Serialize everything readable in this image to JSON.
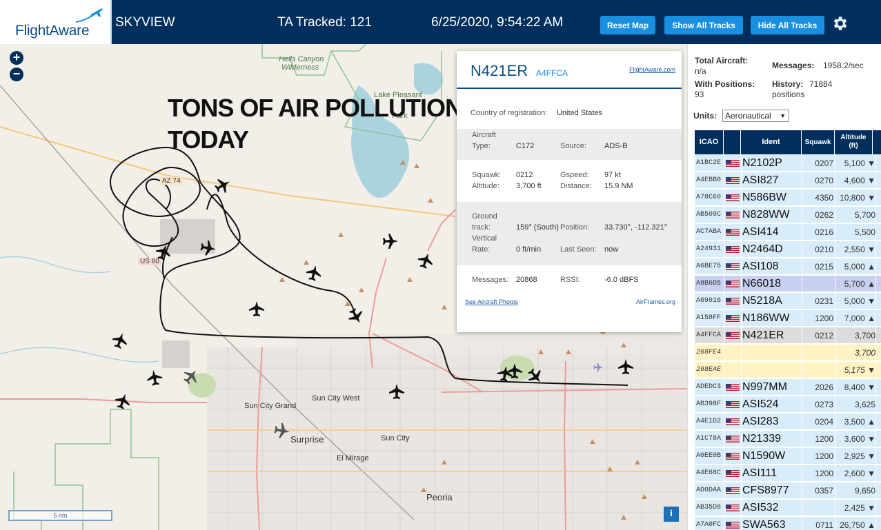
{
  "header": {
    "logo": "FlightAware",
    "app_name": "SKYVIEW",
    "ta_tracked": "TA Tracked: 121",
    "datetime": "6/25/2020, 9:54:22 AM",
    "buttons": {
      "reset_map": "Reset Map",
      "show_all_tracks": "Show All Tracks",
      "hide_all_tracks": "Hide All Tracks"
    },
    "accent_color": "#1a8fe0",
    "bar_color": "#002f5d"
  },
  "map": {
    "zoom_in": "+",
    "zoom_out": "−",
    "overlay_text_line1": "TONS OF AIR POLLUTION",
    "overlay_text_line2": "TODAY",
    "scale_label": "5 nm",
    "info_label": "i",
    "labels": {
      "hells_canyon": "Hells Canyon",
      "wilderness": "Wilderness",
      "lake_pleasant": "Lake Pleasant",
      "park": "Park",
      "az74": "AZ 74",
      "us60": "US 60",
      "sun_city_west": "Sun City West",
      "sun_city_grand": "Sun City Grand",
      "surprise": "Surprise",
      "sun_city": "Sun City",
      "el_mirage": "El Mirage",
      "peoria": "Peoria"
    }
  },
  "popup": {
    "ident": "N421ER",
    "hex": "A4FFCA",
    "fa_link": "FlightAware.com",
    "country_label": "Country of registration:",
    "country": "United States",
    "aircraft_type_label": "Aircraft Type:",
    "aircraft_type_l1": "Aircraft",
    "aircraft_type_l2": "Type:",
    "aircraft_type": "C172",
    "source_label": "Source:",
    "source": "ADS-B",
    "squawk_label": "Squawk:",
    "squawk": "0212",
    "gspeed_label": "Gspeed:",
    "gspeed": "97 kt",
    "altitude_label": "Altitude:",
    "altitude": "3,700 ft",
    "distance_label": "Distance:",
    "distance": "15.9 NM",
    "ground_track_l1": "Ground",
    "ground_track_l2": "track:",
    "ground_track": "159° (South)",
    "position_label": "Position:",
    "position": "33.730°, -112.321°",
    "vrate_l1": "Vertical",
    "vrate_l2": "Rate:",
    "vrate": "0 ft/min",
    "last_seen_label": "Last Seen:",
    "last_seen": "now",
    "messages_label": "Messages:",
    "messages": "20868",
    "rssi_label": "RSSI:",
    "rssi": "-6.0 dBFS",
    "photos_link": "See Aircraft Photos",
    "airframes_link": "AirFrames.org"
  },
  "sidebar": {
    "total_aircraft_label": "Total Aircraft:",
    "total_aircraft": "n/a",
    "with_positions_label": "With Positions:",
    "with_positions": "93",
    "messages_label": "Messages:",
    "messages": "1958.2/sec",
    "history_label": "History:",
    "history": "71884",
    "history_unit": "positions",
    "units_label": "Units:",
    "units_value": "Aeronautical",
    "columns": {
      "icao": "ICAO",
      "ident": "Ident",
      "squawk": "Squawk",
      "altitude_l1": "Altitude",
      "altitude_l2": "(ft)"
    },
    "rows": [
      {
        "icao": "A1BC2E",
        "ident": "N2102P",
        "squawk": "0207",
        "alt": "5,100 ▼",
        "style": "blue",
        "flag": true
      },
      {
        "icao": "A4EBB0",
        "ident": "ASI827",
        "squawk": "0270",
        "alt": "4,600 ▼",
        "style": "blue",
        "flag": true
      },
      {
        "icao": "A78C60",
        "ident": "N586BW",
        "squawk": "4350",
        "alt": "10,800 ▼",
        "style": "blue",
        "flag": true
      },
      {
        "icao": "AB509C",
        "ident": "N828WW",
        "squawk": "0262",
        "alt": "5,700",
        "style": "blue",
        "flag": true
      },
      {
        "icao": "AC7ABA",
        "ident": "ASI414",
        "squawk": "0216",
        "alt": "5,500",
        "style": "blue",
        "flag": true
      },
      {
        "icao": "A24931",
        "ident": "N2464D",
        "squawk": "0210",
        "alt": "2,550 ▼",
        "style": "blue",
        "flag": true
      },
      {
        "icao": "A6BE75",
        "ident": "ASI108",
        "squawk": "0215",
        "alt": "5,000 ▲",
        "style": "blue",
        "flag": true
      },
      {
        "icao": "A8B6D5",
        "ident": "N66018",
        "squawk": "",
        "alt": "5,700 ▲",
        "style": "sel",
        "flag": true
      },
      {
        "icao": "A69016",
        "ident": "N5218A",
        "squawk": "0231",
        "alt": "5,000 ▼",
        "style": "blue",
        "flag": true
      },
      {
        "icao": "A158FF",
        "ident": "N186WW",
        "squawk": "1200",
        "alt": "7,000 ▲",
        "style": "blue",
        "flag": true
      },
      {
        "icao": "A4FFCA",
        "ident": "N421ER",
        "squawk": "0212",
        "alt": "3,700",
        "style": "gray",
        "flag": true
      },
      {
        "icao": "268FE4",
        "ident": "",
        "squawk": "",
        "alt": "3,700",
        "style": "yellow",
        "flag": false
      },
      {
        "icao": "268EAE",
        "ident": "",
        "squawk": "",
        "alt": "5,175 ▼",
        "style": "yellow",
        "flag": false
      },
      {
        "icao": "ADEDC3",
        "ident": "N997MM",
        "squawk": "2026",
        "alt": "8,400 ▼",
        "style": "blue",
        "flag": true
      },
      {
        "icao": "AB398F",
        "ident": "ASI524",
        "squawk": "0273",
        "alt": "3,625",
        "style": "blue",
        "flag": true
      },
      {
        "icao": "A4E1D2",
        "ident": "ASI283",
        "squawk": "0204",
        "alt": "3,500 ▲",
        "style": "blue",
        "flag": true
      },
      {
        "icao": "A1C78A",
        "ident": "N21339",
        "squawk": "1200",
        "alt": "3,600 ▼",
        "style": "blue",
        "flag": true
      },
      {
        "icao": "A0EE0B",
        "ident": "N1590W",
        "squawk": "1200",
        "alt": "2,925 ▼",
        "style": "blue",
        "flag": true
      },
      {
        "icao": "A4E68C",
        "ident": "ASI111",
        "squawk": "1200",
        "alt": "2,600 ▼",
        "style": "blue",
        "flag": true
      },
      {
        "icao": "AD0DAA",
        "ident": "CFS8977",
        "squawk": "0357",
        "alt": "9,650",
        "style": "blue",
        "flag": true
      },
      {
        "icao": "AB35D8",
        "ident": "ASI532",
        "squawk": "",
        "alt": "2,425 ▼",
        "style": "blue",
        "flag": true
      },
      {
        "icao": "A7A0FC",
        "ident": "SWA563",
        "squawk": "0711",
        "alt": "26,750 ▲",
        "style": "blue",
        "flag": true
      }
    ]
  }
}
